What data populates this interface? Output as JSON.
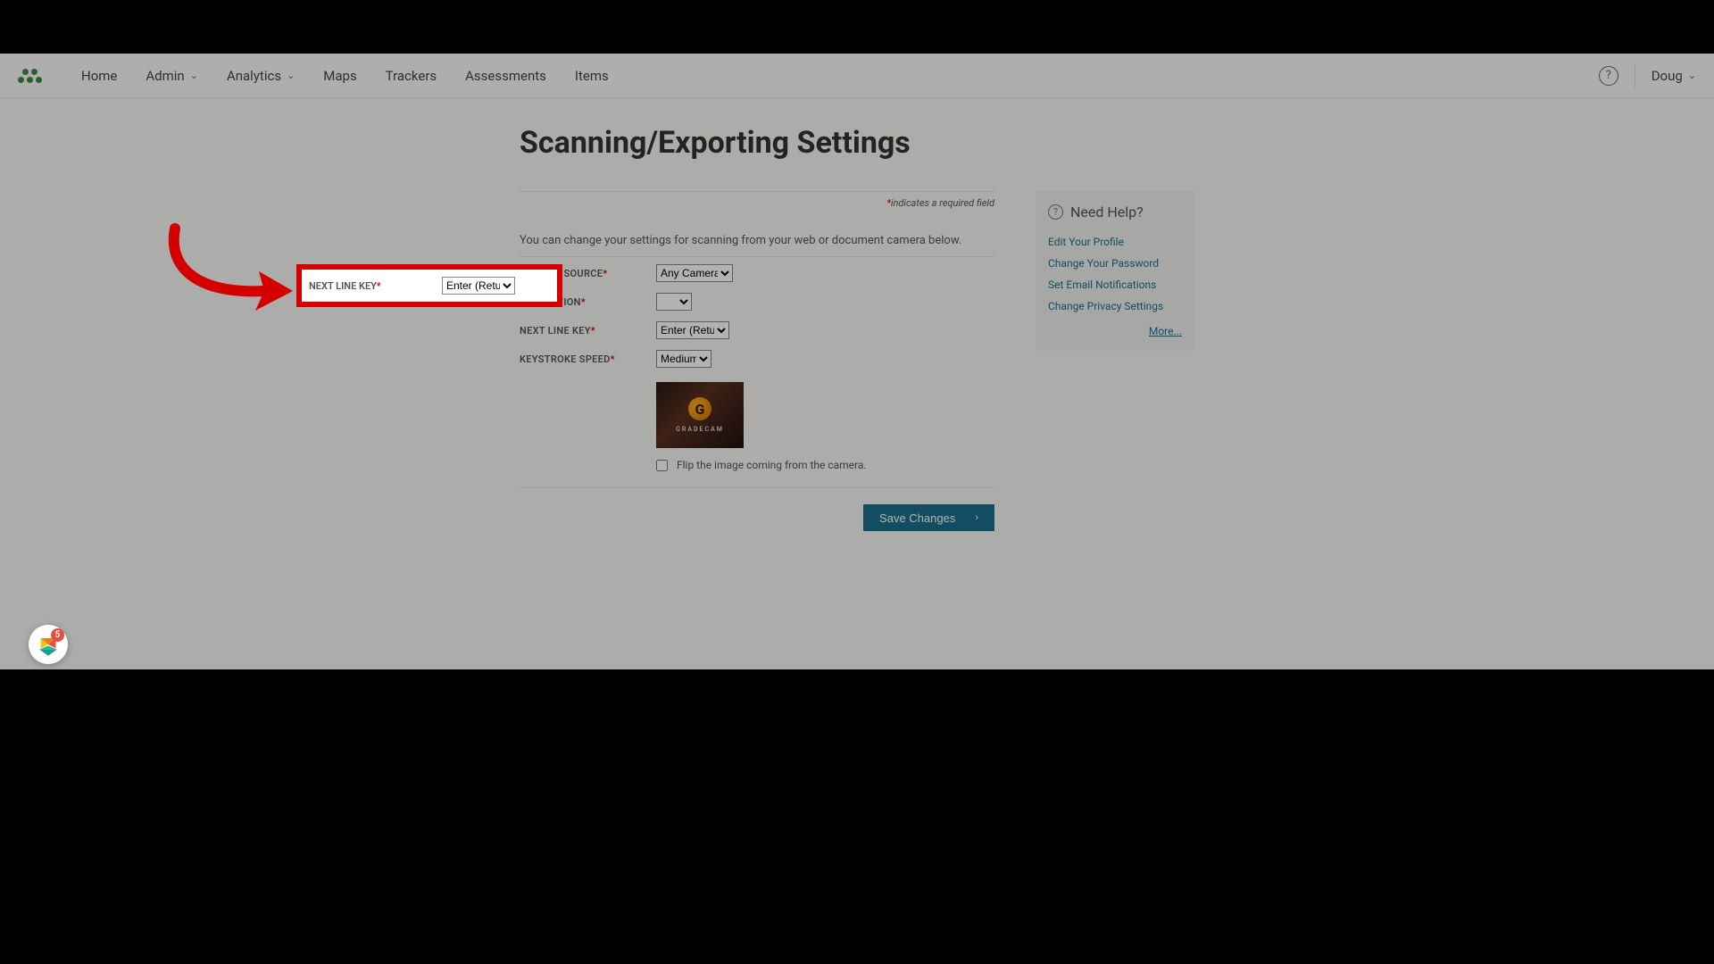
{
  "nav": {
    "items": [
      "Home",
      "Admin",
      "Analytics",
      "Maps",
      "Trackers",
      "Assessments",
      "Items"
    ],
    "user": "Doug"
  },
  "page": {
    "title": "Scanning/Exporting Settings",
    "required_note_prefix": "*",
    "required_note": "indicates a required field",
    "description": "You can change your settings for scanning from your web or document camera below."
  },
  "fields": {
    "camera_source": {
      "label": "CAMERA SOURCE",
      "value": "Any Camera"
    },
    "resolution": {
      "label": "RESOLUTION",
      "value": ""
    },
    "next_line_key": {
      "label": "NEXT LINE KEY",
      "value": "Enter (Return)"
    },
    "keystroke_speed": {
      "label": "KEYSTROKE SPEED",
      "value": "Medium"
    },
    "preview_brand": "GRADECAM",
    "flip_label": "Flip the image coming from the camera."
  },
  "buttons": {
    "save": "Save Changes"
  },
  "help": {
    "title": "Need Help?",
    "links": [
      "Edit Your Profile",
      "Change Your Password",
      "Set Email Notifications",
      "Change Privacy Settings"
    ],
    "more": "More..."
  },
  "widget": {
    "badge": "5"
  }
}
